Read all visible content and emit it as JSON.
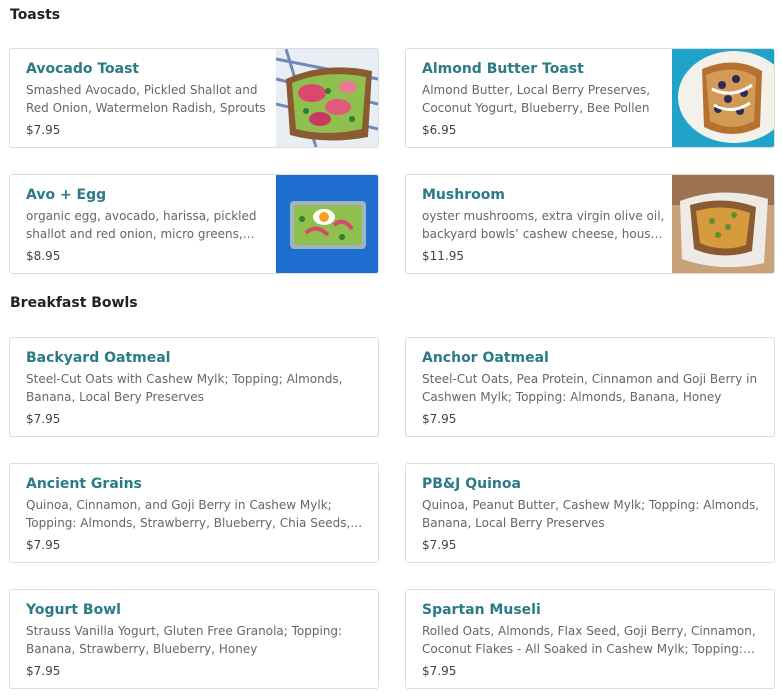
{
  "sections": {
    "toasts": {
      "title": "Toasts",
      "items": [
        {
          "name": "Avocado Toast",
          "description": "Smashed Avocado, Pickled Shallot and Red Onion, Watermelon Radish, Sprouts",
          "price": "$7.95"
        },
        {
          "name": "Almond Butter Toast",
          "description": "Almond Butter, Local Berry Preserves, Coconut Yogurt, Blueberry, Bee Pollen",
          "price": "$6.95"
        },
        {
          "name": "Avo + Egg",
          "description": "organic egg, avocado, harissa, pickled shallot and red onion, micro greens, sprouts",
          "price": "$8.95"
        },
        {
          "name": "Mushroom",
          "description": "oyster mushrooms, extra virgin olive oil, backyard bowls’ cashew cheese, house greens",
          "price": "$11.95"
        }
      ]
    },
    "breakfast_bowls": {
      "title": "Breakfast Bowls",
      "items": [
        {
          "name": "Backyard Oatmeal",
          "description": "Steel-Cut Oats with Cashew Mylk; Topping; Almonds, Banana, Local Bery Preserves",
          "price": "$7.95"
        },
        {
          "name": "Anchor Oatmeal",
          "description": "Steel-Cut Oats, Pea Protein, Cinnamon and Goji Berry in Cashwen Mylk; Topping: Almonds, Banana, Honey",
          "price": "$7.95"
        },
        {
          "name": "Ancient Grains",
          "description": "Quinoa, Cinnamon, and Goji Berry in Cashew Mylk; Topping: Almonds, Strawberry, Blueberry, Chia Seeds, Honey",
          "price": "$7.95"
        },
        {
          "name": "PB&J Quinoa",
          "description": "Quinoa, Peanut Butter, Cashew Mylk; Topping: Almonds, Banana, Local Berry Preserves",
          "price": "$7.95"
        },
        {
          "name": "Yogurt Bowl",
          "description": "Strauss Vanilla Yogurt, Gluten Free Granola; Topping: Banana, Strawberry, Blueberry, Honey",
          "price": "$7.95"
        },
        {
          "name": "Spartan Museli",
          "description": "Rolled Oats, Almonds, Flax Seed, Goji Berry, Cinnamon, Coconut Flakes - All Soaked in Cashew Mylk; Topping: Banana",
          "price": "$7.95"
        }
      ]
    }
  },
  "colors": {
    "item_name": "#2a7b86",
    "border": "#dcdcdc"
  }
}
